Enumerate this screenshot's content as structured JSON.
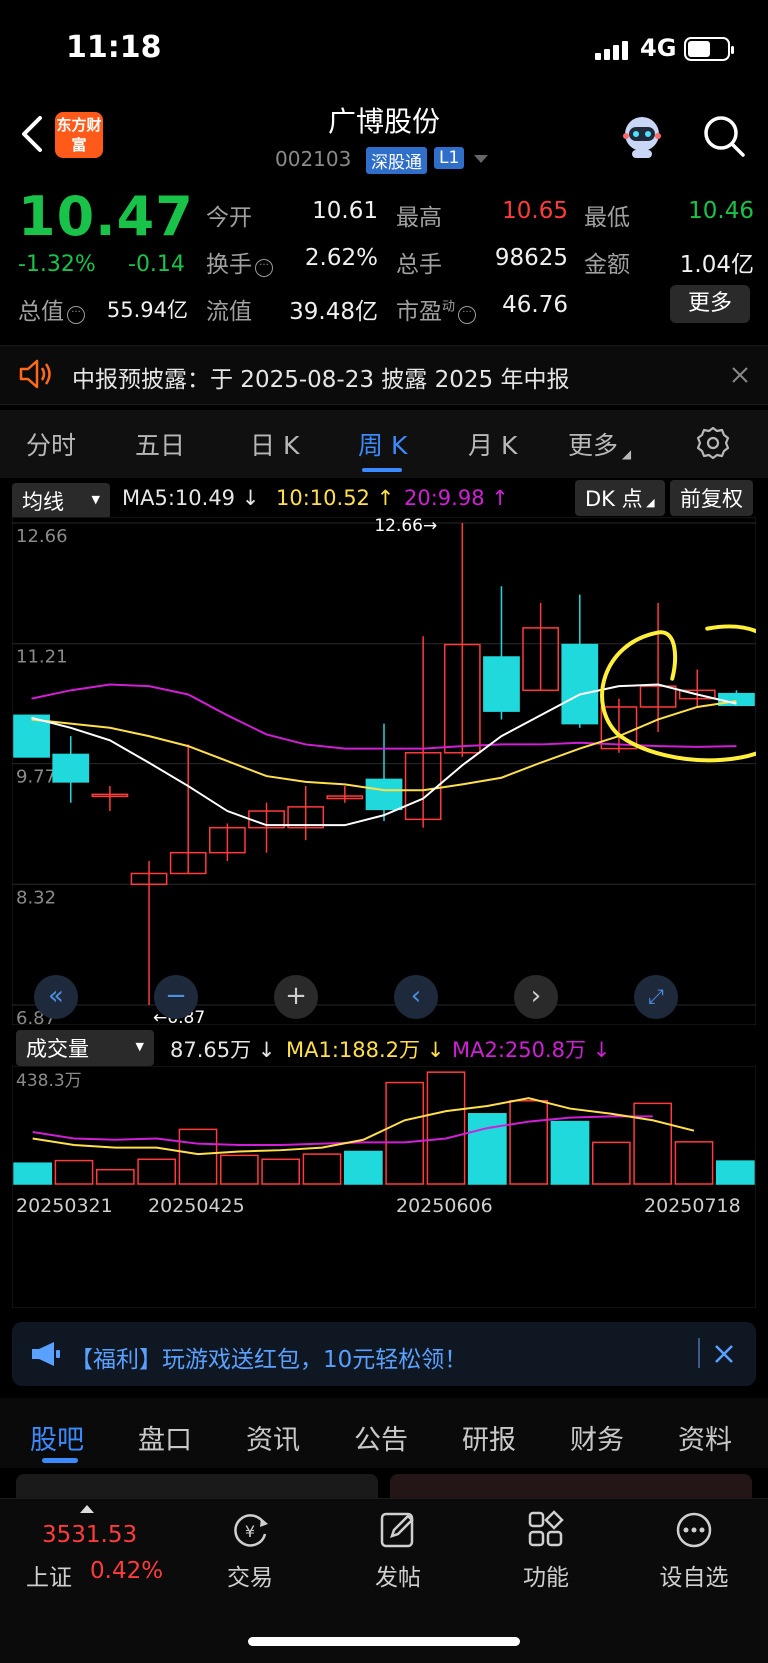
{
  "status": {
    "time": "11:18",
    "network": "4G"
  },
  "header": {
    "app_logo": "东方财富",
    "stock_name": "广博股份",
    "stock_code": "002103",
    "badge_connect": "深股通",
    "badge_level": "L1"
  },
  "quote": {
    "price": "10.47",
    "change_pct": "-1.32%",
    "change_amt": "-0.14",
    "open_label": "今开",
    "open": "10.61",
    "high_label": "最高",
    "high": "10.65",
    "low_label": "最低",
    "low": "10.46",
    "turnover_label": "换手",
    "turnover": "2.62%",
    "volume_label": "总手",
    "volume": "98625",
    "amount_label": "金额",
    "amount": "1.04亿",
    "mktcap_label": "总值",
    "mktcap": "55.94亿",
    "float_label": "流值",
    "float": "39.48亿",
    "pe_label": "市盈",
    "pe_sup": "动",
    "pe": "46.76",
    "more": "更多"
  },
  "notice": {
    "text": "中报预披露：于 2025-08-23 披露 2025 年中报"
  },
  "tabs": [
    "分时",
    "五日",
    "日 K",
    "周 K",
    "月 K",
    "更多"
  ],
  "toolbar": {
    "indicator": "均线",
    "ma5": "MA5:10.49",
    "ma10": "10:10.52",
    "ma20": "20:9.98",
    "dk": "DK 点",
    "adjust": "前复权"
  },
  "volume_bar": {
    "indicator": "成交量",
    "current": "87.65万",
    "ma1": "MA1:188.2万",
    "ma2": "MA2:250.8万",
    "max_label": "438.3万"
  },
  "chart_data": {
    "type": "candlestick",
    "y_labels": [
      "12.66",
      "11.21",
      "9.77",
      "8.32",
      "6.87"
    ],
    "ylim": [
      6.87,
      12.66
    ],
    "high_marker": "12.66→",
    "low_marker": "←6.87",
    "x_labels": [
      "20250321",
      "20250425",
      "20250606",
      "20250718"
    ],
    "candles": [
      {
        "o": 10.35,
        "h": 10.35,
        "l": 9.85,
        "c": 9.85
      },
      {
        "o": 9.88,
        "h": 10.1,
        "l": 9.3,
        "c": 9.55
      },
      {
        "o": 9.4,
        "h": 9.5,
        "l": 9.2,
        "c": 9.4
      },
      {
        "o": 8.32,
        "h": 8.6,
        "l": 6.87,
        "c": 8.45
      },
      {
        "o": 8.45,
        "h": 10.0,
        "l": 8.45,
        "c": 8.7
      },
      {
        "o": 8.7,
        "h": 9.05,
        "l": 8.6,
        "c": 9.0
      },
      {
        "o": 9.0,
        "h": 9.3,
        "l": 8.7,
        "c": 9.2
      },
      {
        "o": 9.0,
        "h": 9.5,
        "l": 8.85,
        "c": 9.25
      },
      {
        "o": 9.35,
        "h": 9.5,
        "l": 9.3,
        "c": 9.38
      },
      {
        "o": 9.58,
        "h": 10.25,
        "l": 9.08,
        "c": 9.22
      },
      {
        "o": 9.1,
        "h": 11.3,
        "l": 9.0,
        "c": 9.9
      },
      {
        "o": 9.9,
        "h": 12.66,
        "l": 9.85,
        "c": 11.2
      },
      {
        "o": 11.05,
        "h": 11.9,
        "l": 10.3,
        "c": 10.4
      },
      {
        "o": 10.65,
        "h": 11.7,
        "l": 10.65,
        "c": 11.4
      },
      {
        "o": 11.2,
        "h": 11.8,
        "l": 10.2,
        "c": 10.25
      },
      {
        "o": 9.95,
        "h": 10.55,
        "l": 9.9,
        "c": 10.45
      },
      {
        "o": 10.45,
        "h": 11.7,
        "l": 10.15,
        "c": 10.7
      },
      {
        "o": 10.55,
        "h": 10.9,
        "l": 10.45,
        "c": 10.65
      },
      {
        "o": 10.61,
        "h": 10.65,
        "l": 10.46,
        "c": 10.47
      }
    ],
    "ma5": [
      10.32,
      10.2,
      10.05,
      9.78,
      9.5,
      9.2,
      9.03,
      9.03,
      9.03,
      9.15,
      9.35,
      9.75,
      10.1,
      10.35,
      10.6,
      10.7,
      10.72,
      10.6,
      10.49
    ],
    "ma10": [
      10.3,
      10.25,
      10.2,
      10.1,
      9.98,
      9.8,
      9.62,
      9.55,
      9.52,
      9.45,
      9.45,
      9.52,
      9.6,
      9.78,
      9.95,
      10.1,
      10.3,
      10.45,
      10.52
    ],
    "ma20": [
      10.55,
      10.65,
      10.72,
      10.7,
      10.6,
      10.35,
      10.12,
      10.0,
      9.95,
      9.95,
      9.95,
      9.98,
      10.0,
      10.0,
      10.02,
      10.0,
      9.98,
      9.97,
      9.98
    ],
    "volumes": [
      80,
      90,
      55,
      95,
      210,
      110,
      95,
      115,
      125,
      390,
      430,
      270,
      320,
      240,
      160,
      310,
      162,
      88
    ],
    "volume_ma1": [
      175,
      150,
      140,
      140,
      115,
      125,
      130,
      140,
      170,
      245,
      280,
      300,
      330,
      290,
      270,
      245,
      205
    ],
    "volume_ma2": [
      200,
      175,
      170,
      175,
      155,
      150,
      150,
      155,
      160,
      160,
      175,
      215,
      240,
      255,
      260,
      260
    ],
    "colors": {
      "up": "#ff3b3b",
      "down": "#20d9dc",
      "ma5": "#ffffff",
      "ma10": "#ffe04a",
      "ma20": "#d11fd6",
      "annotation": "#ffef3a"
    }
  },
  "promo": {
    "text": "【福利】玩游戏送红包，10元轻松领！"
  },
  "bottom_tabs": [
    "股吧",
    "盘口",
    "资讯",
    "公告",
    "研报",
    "财务",
    "资料"
  ],
  "tabbar": {
    "index_value": "3531.53",
    "index_name": "上证",
    "index_change": "0.42%",
    "items": [
      "交易",
      "发帖",
      "功能",
      "设自选"
    ]
  }
}
